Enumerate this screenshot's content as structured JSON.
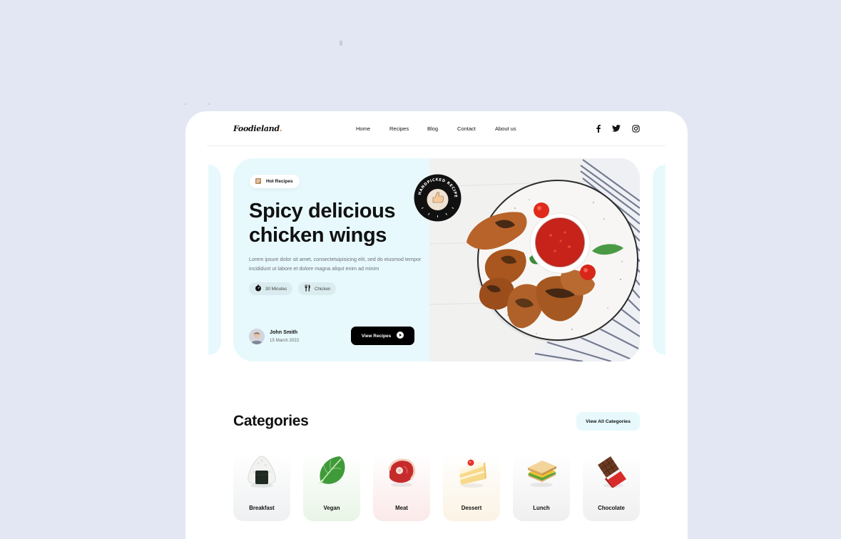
{
  "brand": {
    "logo": "Foodieland",
    "logo_dot": "."
  },
  "nav": {
    "items": [
      "Home",
      "Recipes",
      "Blog",
      "Contact",
      "About us"
    ]
  },
  "social": [
    "facebook-icon",
    "twitter-icon",
    "instagram-icon"
  ],
  "hero": {
    "badge": "Hot Recipes",
    "title_line1": "Spicy delicious",
    "title_line2": "chicken wings",
    "description": "Lorem ipsum dolor sit amet, consectetuipisicing elit, sed do eiusmod tempor incididunt ut labore et dolore magna aliqut enim ad minim",
    "tags": [
      {
        "icon": "timer-icon",
        "label": "30 Minutes"
      },
      {
        "icon": "fork-knife-icon",
        "label": "Chicken"
      }
    ],
    "author": {
      "name": "John Smith",
      "date": "15 March 2022"
    },
    "cta": "View Recipes",
    "stamp_text": "HANDPICKED RECIPES"
  },
  "categories": {
    "title": "Categories",
    "view_all": "View All Categories",
    "items": [
      {
        "label": "Breakfast",
        "icon": "rice-ball-icon",
        "bg": "#eef0f1"
      },
      {
        "label": "Vegan",
        "icon": "leaf-icon",
        "bg": "#e8f5e6"
      },
      {
        "label": "Meat",
        "icon": "steak-icon",
        "bg": "#fbe9e9"
      },
      {
        "label": "Dessert",
        "icon": "cake-icon",
        "bg": "#fbf3e4"
      },
      {
        "label": "Lunch",
        "icon": "sandwich-icon",
        "bg": "#efefef"
      },
      {
        "label": "Chocolate",
        "icon": "chocolate-icon",
        "bg": "#f0f0f0"
      }
    ]
  },
  "colors": {
    "background": "#e3e6f3",
    "hero_bg": "#e7f9fd",
    "accent": "#000000"
  }
}
